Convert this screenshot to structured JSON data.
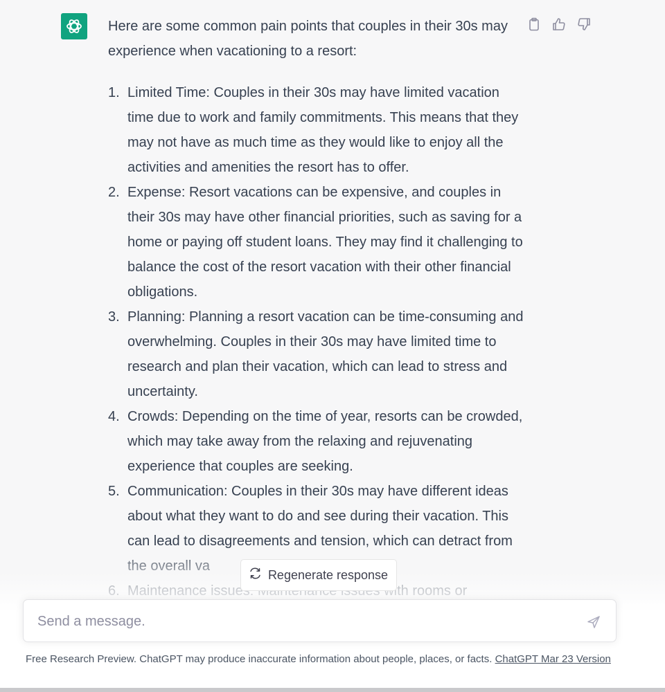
{
  "message": {
    "intro": "Here are some common pain points that couples in their 30s may experience when vacationing to a resort:",
    "points": [
      {
        "num": "1.",
        "text": "Limited Time: Couples in their 30s may have limited vacation time due to work and family commitments. This means that they may not have as much time as they would like to enjoy all the activities and amenities the resort has to offer."
      },
      {
        "num": "2.",
        "text": "Expense: Resort vacations can be expensive, and couples in their 30s may have other financial priorities, such as saving for a home or paying off student loans. They may find it challenging to balance the cost of the resort vacation with their other financial obligations."
      },
      {
        "num": "3.",
        "text": "Planning: Planning a resort vacation can be time-consuming and overwhelming. Couples in their 30s may have limited time to research and plan their vacation, which can lead to stress and uncertainty."
      },
      {
        "num": "4.",
        "text": "Crowds: Depending on the time of year, resorts can be crowded, which may take away from the relaxing and rejuvenating experience that couples are seeking."
      },
      {
        "num": "5.",
        "text": "Communication: Couples in their 30s may have different ideas about what they want to do and see during their vacation. This can lead to disagreements and tension, which can detract from the overall va"
      },
      {
        "num": "6.",
        "text": "Maintenance issues: Maintenance issues with rooms or"
      }
    ]
  },
  "actions": {
    "copy_icon": "clipboard-icon",
    "like_icon": "thumbs-up-icon",
    "dislike_icon": "thumbs-down-icon"
  },
  "regenerate": {
    "label": "Regenerate response",
    "icon": "refresh-icon"
  },
  "composer": {
    "placeholder": "Send a message.",
    "send_icon": "paper-plane-icon"
  },
  "footer": {
    "text": "Free Research Preview. ChatGPT may produce inaccurate information about people, places, or facts. ",
    "link": "ChatGPT Mar 23 Version"
  },
  "colors": {
    "brand": "#10a37f",
    "background": "#f7f7f8",
    "text": "#374151"
  }
}
